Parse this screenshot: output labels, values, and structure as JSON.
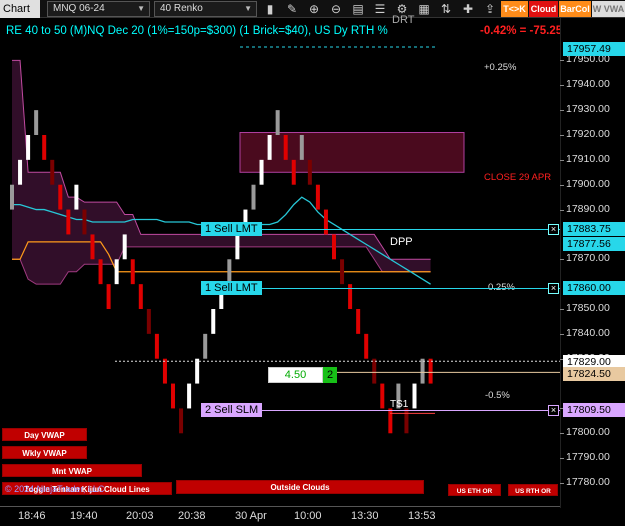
{
  "toolbar": {
    "chart_label": "Chart",
    "instrument": "MNQ 06-24",
    "period": "40 Renko",
    "tk_button": "T<>K",
    "cloud_button": "Cloud",
    "barcol_button": "BarCol",
    "vwap_button": "W VWA",
    "icons": [
      "bar-style-icon",
      "draw-tools-icon",
      "zoom-in-icon",
      "zoom-out-icon",
      "data-box-icon",
      "properties-icon",
      "strategies-icon",
      "templates-icon",
      "chart-trader-icon",
      "order-icon",
      "share-icon",
      "reload-icon",
      "attach-icon",
      "scroll-icon"
    ]
  },
  "header": {
    "title": "RE 40 to 50 (M)NQ Dec 20 (1%=150p=$300) (1 Brick=$40), US Dy RTH %",
    "pnl": "-0.42% = -75.25",
    "drt": "DRT",
    "title_color": "#00ffff",
    "pnl_color": "#ff2020"
  },
  "annotations": {
    "plus_025": "+0.25%",
    "close_29_apr": "CLOSE 29 APR",
    "dpp": "DPP",
    "pct_025": "0.25%",
    "minus_05": "-0.5%",
    "ts1": "TS1",
    "copyright": "© 2024 NinjaTrader, LLC"
  },
  "orders": {
    "sell_lmt_1": {
      "label": "1 Sell LMT",
      "price": "17883.75",
      "color": "#27d7ea"
    },
    "sell_lmt_2": {
      "label": "1 Sell LMT",
      "price": "17860.00",
      "color": "#27d7ea"
    },
    "sell_slm": {
      "label": "2 Sell SLM",
      "price": "17809.50",
      "color": "#d9a6ff"
    },
    "cancel_glyph": "×"
  },
  "position": {
    "pnl_box": "4.50",
    "qty": "2"
  },
  "price_axis": {
    "ticks": [
      "17950.00",
      "17940.00",
      "17930.00",
      "17920.00",
      "17910.00",
      "17900.00",
      "17890.00",
      "17870.00",
      "17850.00",
      "17840.00",
      "17830.00",
      "17810.00",
      "17800.00",
      "17790.00",
      "17780.00"
    ],
    "last_price": "17829.00",
    "current": "17824.50",
    "top_tag": "17957.49",
    "ma_tag": "17877.56"
  },
  "time_axis": {
    "labels": [
      "18:46",
      "19:40",
      "20:03",
      "20:38",
      "30 Apr",
      "10:00",
      "13:30",
      "13:53"
    ]
  },
  "side_buttons": {
    "day_vwap": "Day VWAP",
    "wkly_vwap": "Wkly VWAP",
    "mnt_vwap": "Mnt VWAP",
    "toggle_tenkan": "Toggle Tenkan Kijun Cloud Lines",
    "outside_clouds": "Outside Clouds",
    "us_eth_or": "US ETH OR",
    "us_rth_or": "US RTH OR"
  },
  "chart_data": {
    "type": "renko",
    "brick_size_points": 10,
    "columns": [
      {
        "o": 17890,
        "c": 17900,
        "dir": "up"
      },
      {
        "o": 17900,
        "c": 17910,
        "dir": "up"
      },
      {
        "o": 17910,
        "c": 17920,
        "dir": "up"
      },
      {
        "o": 17920,
        "c": 17930,
        "dir": "up"
      },
      {
        "o": 17920,
        "c": 17910,
        "dir": "down"
      },
      {
        "o": 17910,
        "c": 17900,
        "dir": "down"
      },
      {
        "o": 17900,
        "c": 17890,
        "dir": "down"
      },
      {
        "o": 17890,
        "c": 17880,
        "dir": "down"
      },
      {
        "o": 17890,
        "c": 17900,
        "dir": "up"
      },
      {
        "o": 17890,
        "c": 17880,
        "dir": "down"
      },
      {
        "o": 17880,
        "c": 17870,
        "dir": "down"
      },
      {
        "o": 17870,
        "c": 17860,
        "dir": "down"
      },
      {
        "o": 17860,
        "c": 17850,
        "dir": "down"
      },
      {
        "o": 17860,
        "c": 17870,
        "dir": "up"
      },
      {
        "o": 17870,
        "c": 17880,
        "dir": "up"
      },
      {
        "o": 17870,
        "c": 17860,
        "dir": "down"
      },
      {
        "o": 17860,
        "c": 17850,
        "dir": "down"
      },
      {
        "o": 17850,
        "c": 17840,
        "dir": "down"
      },
      {
        "o": 17840,
        "c": 17830,
        "dir": "down"
      },
      {
        "o": 17830,
        "c": 17820,
        "dir": "down"
      },
      {
        "o": 17820,
        "c": 17810,
        "dir": "down"
      },
      {
        "o": 17810,
        "c": 17800,
        "dir": "down"
      },
      {
        "o": 17810,
        "c": 17820,
        "dir": "up"
      },
      {
        "o": 17820,
        "c": 17830,
        "dir": "up"
      },
      {
        "o": 17830,
        "c": 17840,
        "dir": "up"
      },
      {
        "o": 17840,
        "c": 17850,
        "dir": "up"
      },
      {
        "o": 17850,
        "c": 17860,
        "dir": "up"
      },
      {
        "o": 17860,
        "c": 17870,
        "dir": "up"
      },
      {
        "o": 17870,
        "c": 17880,
        "dir": "up"
      },
      {
        "o": 17880,
        "c": 17890,
        "dir": "up"
      },
      {
        "o": 17890,
        "c": 17900,
        "dir": "up"
      },
      {
        "o": 17900,
        "c": 17910,
        "dir": "up"
      },
      {
        "o": 17910,
        "c": 17920,
        "dir": "up"
      },
      {
        "o": 17920,
        "c": 17930,
        "dir": "up"
      },
      {
        "o": 17920,
        "c": 17910,
        "dir": "down"
      },
      {
        "o": 17910,
        "c": 17900,
        "dir": "down"
      },
      {
        "o": 17910,
        "c": 17920,
        "dir": "up"
      },
      {
        "o": 17910,
        "c": 17900,
        "dir": "down"
      },
      {
        "o": 17900,
        "c": 17890,
        "dir": "down"
      },
      {
        "o": 17890,
        "c": 17880,
        "dir": "down"
      },
      {
        "o": 17880,
        "c": 17870,
        "dir": "down"
      },
      {
        "o": 17870,
        "c": 17860,
        "dir": "down"
      },
      {
        "o": 17860,
        "c": 17850,
        "dir": "down"
      },
      {
        "o": 17850,
        "c": 17840,
        "dir": "down"
      },
      {
        "o": 17840,
        "c": 17830,
        "dir": "down"
      },
      {
        "o": 17830,
        "c": 17820,
        "dir": "down"
      },
      {
        "o": 17820,
        "c": 17810,
        "dir": "down"
      },
      {
        "o": 17810,
        "c": 17800,
        "dir": "down"
      },
      {
        "o": 17810,
        "c": 17820,
        "dir": "up"
      },
      {
        "o": 17810,
        "c": 17800,
        "dir": "down"
      },
      {
        "o": 17810,
        "c": 17820,
        "dir": "up"
      },
      {
        "o": 17820,
        "c": 17830,
        "dir": "up"
      },
      {
        "o": 17830,
        "c": 17820,
        "dir": "down"
      }
    ],
    "ma_line": [
      17892,
      17892,
      17891,
      17890,
      17890,
      17889,
      17888,
      17887,
      17886,
      17886,
      17885,
      17885,
      17885,
      17885,
      17885,
      17886,
      17886,
      17886,
      17886,
      17885,
      17885,
      17885,
      17885,
      17884,
      17884,
      17884,
      17884,
      17884,
      17884,
      17884,
      17884,
      17884,
      17884,
      17885,
      17888,
      17892,
      17895,
      17893,
      17889,
      17886,
      17884,
      17882,
      17880,
      17878,
      17876,
      17874,
      17872,
      17870,
      17868,
      17866,
      17864,
      17862,
      17860
    ],
    "orange_line": [
      17870,
      17870,
      17877,
      17877,
      17877,
      17877,
      17877,
      17877,
      17877,
      17877,
      17877,
      17877,
      17872,
      17865,
      17865,
      17865,
      17865,
      17865,
      17865,
      17865,
      17865,
      17865,
      17865,
      17865,
      17865,
      17865,
      17865,
      17865,
      17865,
      17865,
      17865,
      17865,
      17865,
      17865,
      17865,
      17865,
      17865,
      17865,
      17865,
      17865,
      17865,
      17865,
      17865,
      17865,
      17865,
      17865,
      17865,
      17865,
      17865,
      17865,
      17865,
      17865,
      17865
    ],
    "cloud_upper": [
      17950,
      17950,
      17905,
      17905,
      17905,
      17905,
      17905,
      17895,
      17895,
      17893,
      17893,
      17893,
      17893,
      17893,
      17888,
      17888,
      17880,
      17880,
      17880,
      17880,
      17880,
      17880,
      17880,
      17880,
      17880,
      17880,
      17880,
      17880,
      17880,
      17880,
      17880,
      17880,
      17880,
      17880,
      17880,
      17880,
      17880,
      17880,
      17880,
      17880,
      17880,
      17880,
      17880,
      17880,
      17880,
      17880,
      17875,
      17870,
      17870,
      17870,
      17870,
      17870,
      17870
    ],
    "cloud_lower": [
      17870,
      17870,
      17862,
      17860,
      17860,
      17860,
      17860,
      17865,
      17865,
      17868,
      17868,
      17868,
      17868,
      17868,
      17875,
      17875,
      17875,
      17875,
      17875,
      17875,
      17875,
      17875,
      17875,
      17875,
      17875,
      17875,
      17875,
      17875,
      17875,
      17875,
      17875,
      17875,
      17875,
      17875,
      17875,
      17875,
      17875,
      17875,
      17875,
      17875,
      17875,
      17875,
      17875,
      17875,
      17875,
      17870,
      17865,
      17865,
      17865,
      17865,
      17865,
      17865,
      17865
    ],
    "price_range": [
      17776,
      17960
    ],
    "resistance_zone": {
      "from": 17905,
      "to": 17921
    },
    "levels": {
      "last": 17829,
      "current": 17824.5,
      "sell_lmt_1": 17883.75,
      "sell_lmt_2": 17860,
      "sell_slm": 17809.5,
      "dpp": 17882,
      "ts1": 17808
    }
  }
}
